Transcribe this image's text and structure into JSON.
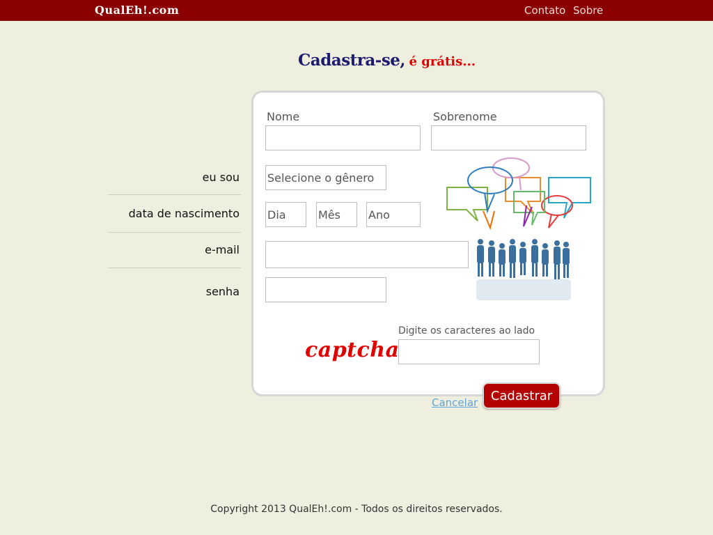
{
  "header": {
    "logo": "QualEh!.com",
    "nav": [
      "Contato",
      "Sobre"
    ]
  },
  "title": {
    "main": "Cadastra-se,",
    "accent": "é grátis..."
  },
  "side_labels": {
    "gender": "eu sou",
    "birth": "data de nascimento",
    "email": "e-mail",
    "password": "senha"
  },
  "form": {
    "first_name_label": "Nome",
    "last_name_label": "Sobrenome",
    "gender_placeholder": "Selecione o gênero",
    "day_placeholder": "Dia",
    "month_placeholder": "Mês",
    "year_placeholder": "Ano",
    "captcha_text": "captcha",
    "captcha_label": "Digite os caracteres ao lado",
    "cancel": "Cancelar",
    "submit": "Cadastrar"
  },
  "footer": "Copyright 2013 QualEh!.com - Todos os direitos reservados.",
  "colors": {
    "topbar": "#8b0000",
    "background": "#efefe0",
    "title_main": "#1c1c6e",
    "title_accent": "#e00000",
    "button": "#b40000",
    "link": "#5fa4d9"
  },
  "illustration": {
    "icon": "people-speech-bubbles-icon"
  }
}
